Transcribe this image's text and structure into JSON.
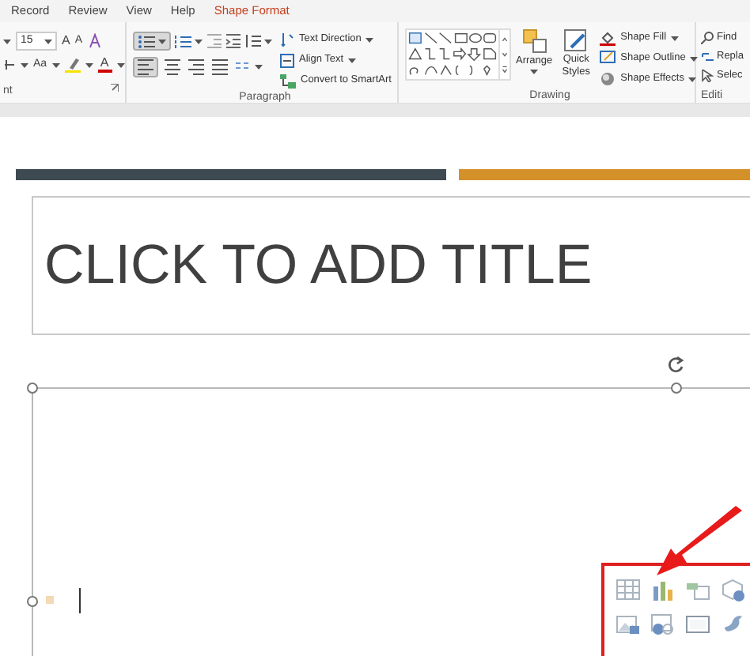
{
  "tabs": [
    {
      "label": "Record",
      "selected": false
    },
    {
      "label": "Review",
      "selected": false
    },
    {
      "label": "View",
      "selected": false
    },
    {
      "label": "Help",
      "selected": false
    },
    {
      "label": "Shape Format",
      "selected": true
    }
  ],
  "ribbon": {
    "font": {
      "size": "15",
      "grow": "A",
      "shrink": "A",
      "change_case": "Aa",
      "font_color": "A",
      "label": "nt"
    },
    "paragraph": {
      "bullets_selected": true,
      "align_left_selected": true,
      "commands": [
        "Text Direction",
        "Align Text",
        "Convert to SmartArt"
      ],
      "label": "Paragraph"
    },
    "drawing": {
      "arrange": "Arrange",
      "quick_styles": "Quick Styles",
      "commands": [
        "Shape Fill",
        "Shape Outline",
        "Shape Effects"
      ],
      "label": "Drawing"
    },
    "editing": {
      "commands": [
        "Find",
        "Repla",
        "Selec"
      ],
      "label": "Editi"
    }
  },
  "slide": {
    "title_placeholder": "CLICK TO ADD TITLE"
  }
}
